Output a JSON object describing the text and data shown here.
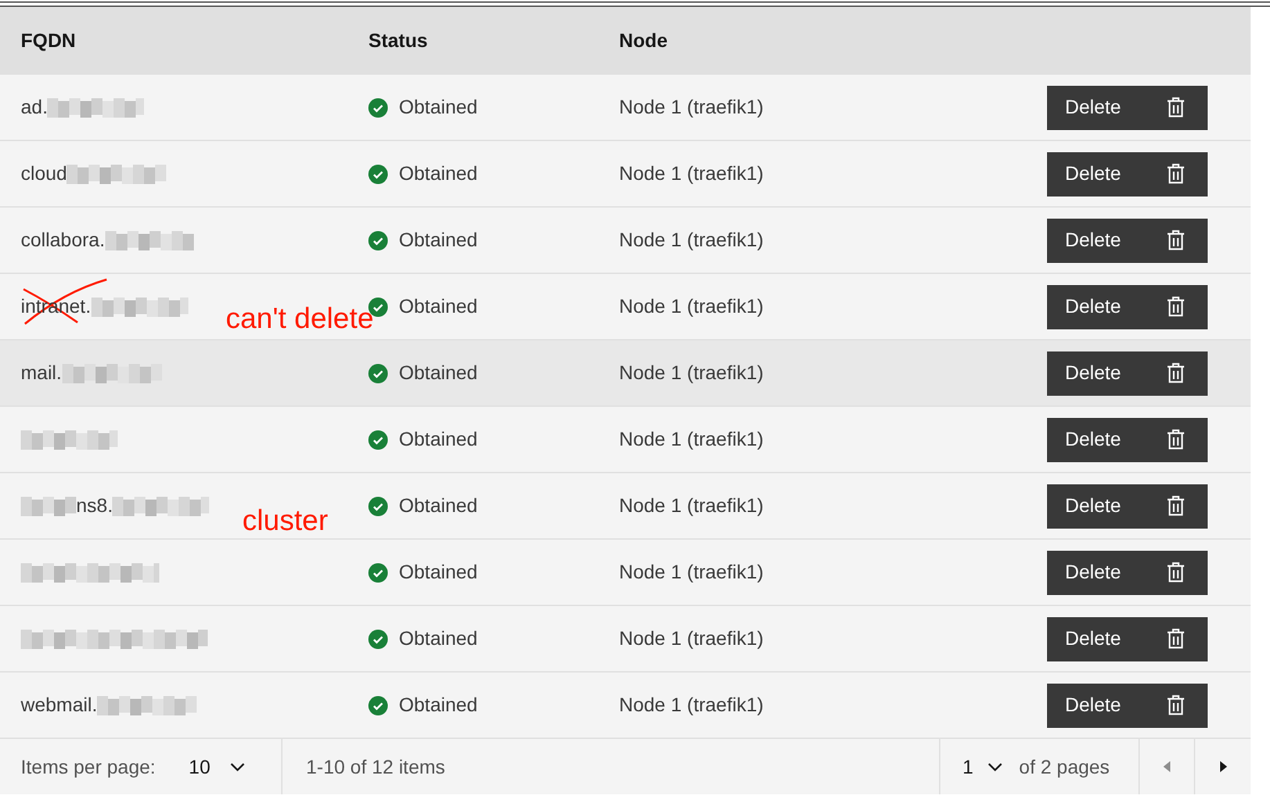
{
  "table": {
    "columns": [
      "FQDN",
      "Status",
      "Node"
    ],
    "rows": [
      {
        "fqdn": "ad.",
        "status": "Obtained",
        "node": "Node 1 (traefik1)",
        "action": "Delete",
        "highlighted": false
      },
      {
        "fqdn": "cloud",
        "status": "Obtained",
        "node": "Node 1 (traefik1)",
        "action": "Delete",
        "highlighted": false
      },
      {
        "fqdn": "collabora.",
        "status": "Obtained",
        "node": "Node 1 (traefik1)",
        "action": "Delete",
        "highlighted": false
      },
      {
        "fqdn": "intranet.",
        "status": "Obtained",
        "node": "Node 1 (traefik1)",
        "action": "Delete",
        "highlighted": false,
        "crossed_out": true,
        "note": "can't delete"
      },
      {
        "fqdn": "mail.",
        "status": "Obtained",
        "node": "Node 1 (traefik1)",
        "action": "Delete",
        "highlighted": true
      },
      {
        "status": "Obtained",
        "node": "Node 1 (traefik1)",
        "action": "Delete",
        "highlighted": false
      },
      {
        "fqdn": "ns8.",
        "status": "Obtained",
        "node": "Node 1 (traefik1)",
        "action": "Delete",
        "highlighted": false,
        "note": "cluster"
      },
      {
        "status": "Obtained",
        "node": "Node 1 (traefik1)",
        "action": "Delete",
        "highlighted": false
      },
      {
        "status": "Obtained",
        "node": "Node 1 (traefik1)",
        "action": "Delete",
        "highlighted": false
      },
      {
        "fqdn": "webmail.",
        "status": "Obtained",
        "node": "Node 1 (traefik1)",
        "action": "Delete",
        "highlighted": false
      }
    ]
  },
  "pagination": {
    "items_per_page_label": "Items per page:",
    "items_per_page": "10",
    "range": "1-10 of 12 items",
    "page": "1",
    "pages_label": "of 2 pages"
  }
}
